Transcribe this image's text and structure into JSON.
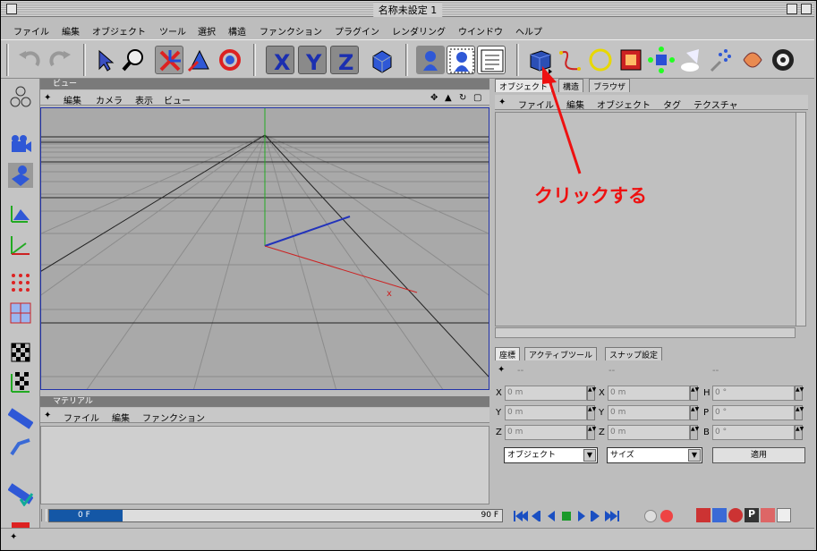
{
  "window": {
    "title": "名称未設定 1"
  },
  "menu": [
    "ファイル",
    "編集",
    "オブジェクト",
    "ツール",
    "選択",
    "構造",
    "ファンクション",
    "プラグイン",
    "レンダリング",
    "ウインドウ",
    "ヘルプ"
  ],
  "view": {
    "header": "ビュー",
    "menu": [
      "編集",
      "カメラ",
      "表示",
      "ビュー"
    ]
  },
  "material": {
    "header": "マテリアル",
    "menu": [
      "ファイル",
      "編集",
      "ファンクション"
    ]
  },
  "object_manager": {
    "tabs": [
      "オブジェクト",
      "構造",
      "ブラウザ"
    ],
    "menu": [
      "ファイル",
      "編集",
      "オブジェクト",
      "タグ",
      "テクスチャ"
    ]
  },
  "coords": {
    "tabs": [
      "座標",
      "アクティブツール",
      "スナップ設定"
    ],
    "dashes": [
      "--",
      "--",
      "--"
    ],
    "row_labels": [
      [
        "X",
        "X",
        "H"
      ],
      [
        "Y",
        "Y",
        "P"
      ],
      [
        "Z",
        "Z",
        "B"
      ]
    ],
    "values": [
      [
        "0 m",
        "0 m",
        "0 °"
      ],
      [
        "0 m",
        "0 m",
        "0 °"
      ],
      [
        "0 m",
        "0 m",
        "0 °"
      ]
    ],
    "mode_select": "オブジェクト",
    "size_select": "サイズ",
    "apply_label": "適用"
  },
  "timeline": {
    "start": "0 F",
    "end": "90 F",
    "progress": 0.0
  },
  "annotation": {
    "text": "クリックする",
    "color": "#ee1111"
  },
  "colors": {
    "x_axis": "#cc2222",
    "y_axis": "#22aa22",
    "z_axis": "#2222cc",
    "accent": "#1a4fa0"
  }
}
